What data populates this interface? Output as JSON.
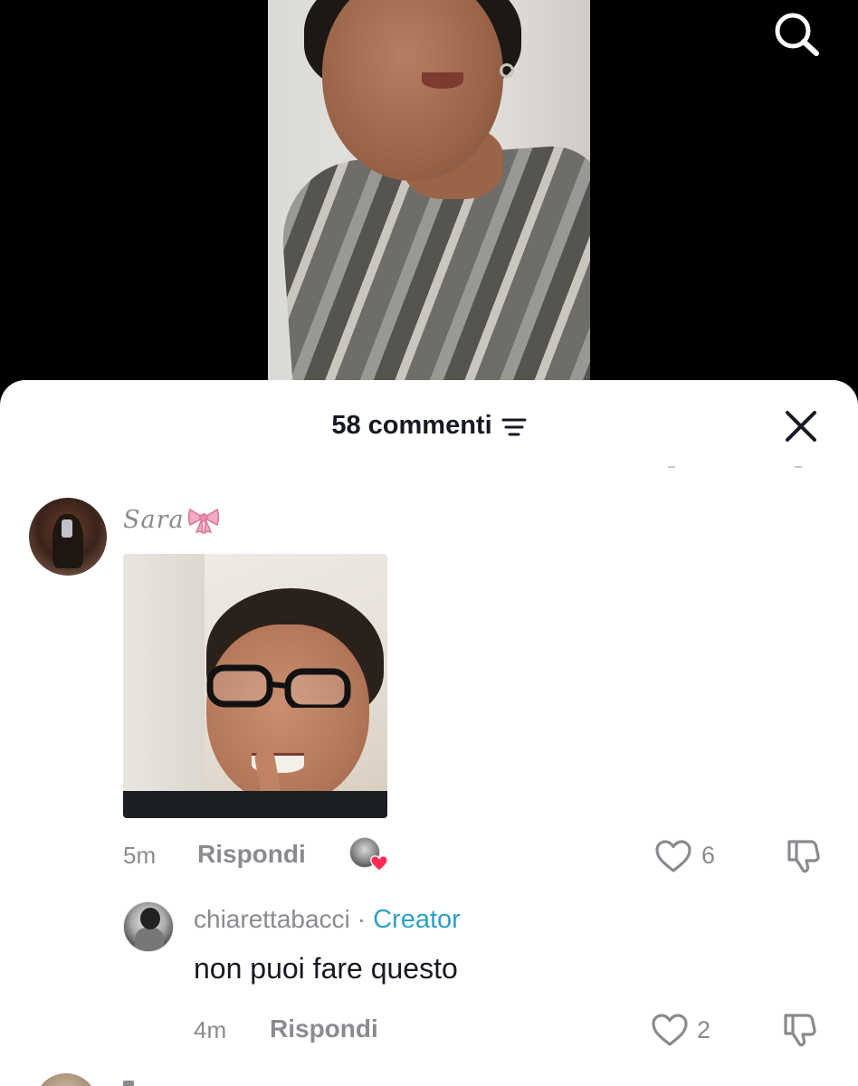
{
  "header": {
    "comment_count_label": "58 commenti",
    "search_icon": "search-icon",
    "sort_icon": "filter-lines-icon",
    "close_icon": "close-icon"
  },
  "comments": [
    {
      "username": "Sara",
      "username_emoji": "ribbon-bow-icon",
      "has_image": true,
      "time": "5m",
      "reply_label": "Rispondi",
      "liked_by_creator": true,
      "likes": "6"
    }
  ],
  "replies": [
    {
      "username": "chiarettabacci",
      "separator": "·",
      "badge": "Creator",
      "text": "non puoi fare questo",
      "time": "4m",
      "reply_label": "Rispondi",
      "likes": "2"
    }
  ],
  "colors": {
    "sheet_bg": "#ffffff",
    "text_primary": "#161823",
    "text_secondary": "#8a8b91",
    "creator_badge": "#2ea1c5",
    "like_heart": "#fe2c55"
  }
}
